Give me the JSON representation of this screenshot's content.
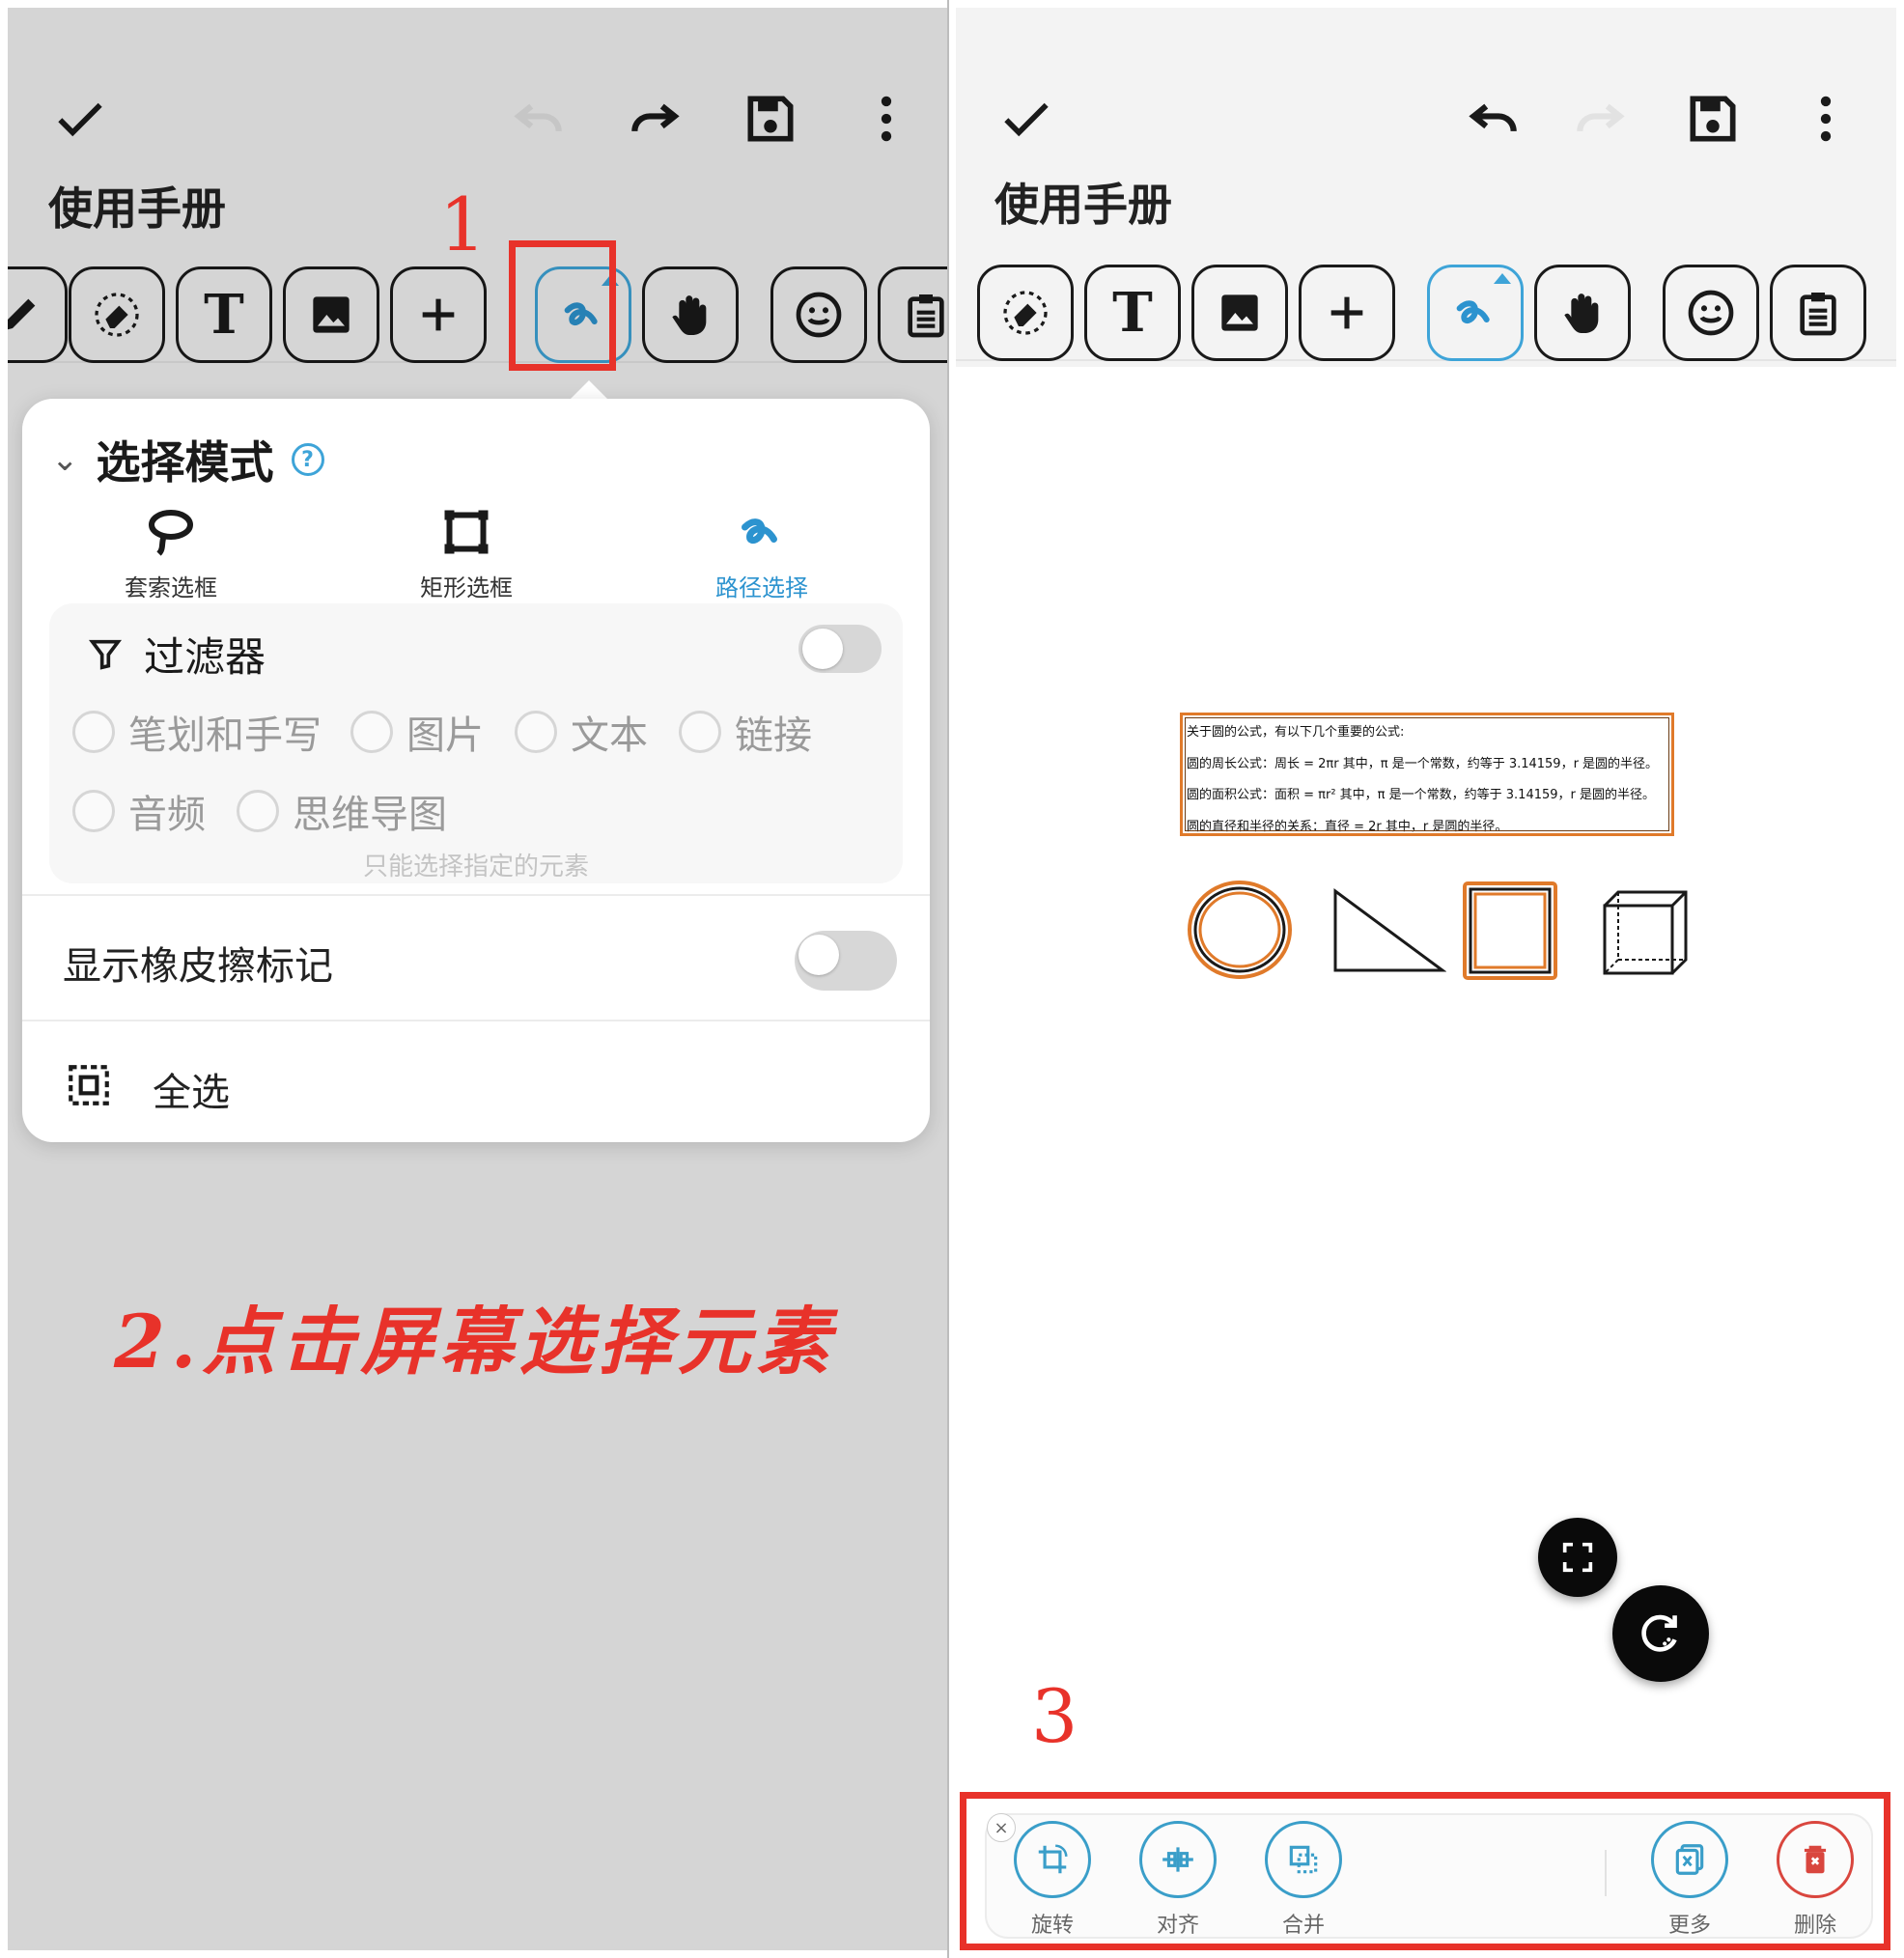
{
  "left": {
    "title": "使用手册",
    "step1": "1",
    "mode_panel": {
      "heading": "选择模式",
      "help": "?",
      "options": [
        {
          "label": "套索选框"
        },
        {
          "label": "矩形选框"
        },
        {
          "label": "路径选择"
        }
      ]
    },
    "filter": {
      "label": "过滤器",
      "items": [
        "笔划和手写",
        "图片",
        "文本",
        "链接",
        "音频",
        "思维导图"
      ],
      "hint": "只能选择指定的元素"
    },
    "eraser_marks": "显示橡皮擦标记",
    "select_all": "全选",
    "instruction": "2.点击屏幕选择元素"
  },
  "right": {
    "title": "使用手册",
    "step3": "3",
    "text_lines": [
      "关于圆的公式，有以下几个重要的公式:",
      "圆的周长公式：周长 = 2πr 其中，π 是一个常数，约等于 3.14159，r 是圆的半径。",
      "圆的面积公式：面积 = πr² 其中，π 是一个常数，约等于 3.14159，r 是圆的半径。",
      "圆的直径和半径的关系：直径 = 2r 其中，r 是圆的半径。"
    ],
    "actions": {
      "rotate": "旋转",
      "align": "对齐",
      "merge": "合并",
      "more": "更多",
      "delete": "删除"
    },
    "close": "×"
  },
  "colors": {
    "accent": "#3ea4d8",
    "highlight_red": "#e8322a",
    "selection_orange": "#e07a2a"
  }
}
